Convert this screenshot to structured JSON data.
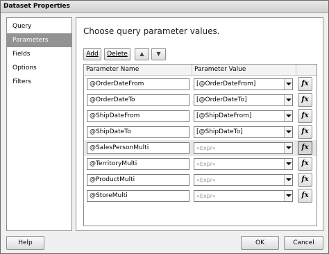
{
  "window": {
    "title": "Dataset Properties"
  },
  "sidebar": {
    "items": [
      {
        "label": "Query",
        "active": false
      },
      {
        "label": "Parameters",
        "active": true
      },
      {
        "label": "Fields",
        "active": false
      },
      {
        "label": "Options",
        "active": false
      },
      {
        "label": "Filters",
        "active": false
      }
    ]
  },
  "main": {
    "heading": "Choose query parameter values.",
    "toolbar": {
      "add_label": "Add",
      "delete_label": "Delete",
      "move_up_label": "▲",
      "move_down_label": "▼"
    },
    "grid": {
      "columns": [
        "Parameter Name",
        "Parameter Value"
      ],
      "expression_button_label": "fx",
      "rows": [
        {
          "name": "@OrderDateFrom",
          "value": "[@OrderDateFrom]",
          "placeholder": false,
          "selected": false
        },
        {
          "name": "@OrderDateTo",
          "value": "[@OrderDateTo]",
          "placeholder": false,
          "selected": false
        },
        {
          "name": "@ShipDateFrom",
          "value": "[@ShipDateFrom]",
          "placeholder": false,
          "selected": false
        },
        {
          "name": "@ShipDateTo",
          "value": "[@ShipDateTo]",
          "placeholder": false,
          "selected": false
        },
        {
          "name": "@SalesPersonMulti",
          "value": "«Expr»",
          "placeholder": true,
          "selected": true
        },
        {
          "name": "@TerritoryMulti",
          "value": "«Expr»",
          "placeholder": true,
          "selected": false
        },
        {
          "name": "@ProductMulti",
          "value": "«Expr»",
          "placeholder": true,
          "selected": false
        },
        {
          "name": "@StoreMulti",
          "value": "«Expr»",
          "placeholder": true,
          "selected": false
        }
      ]
    }
  },
  "footer": {
    "help_label": "Help",
    "ok_label": "OK",
    "cancel_label": "Cancel"
  }
}
